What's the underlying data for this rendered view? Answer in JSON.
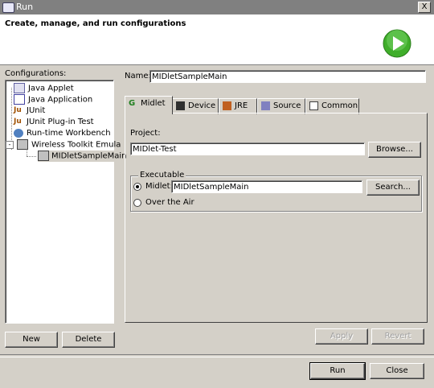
{
  "window": {
    "title": "Run",
    "close_glyph": "X"
  },
  "header": {
    "title": "Create, manage, and run configurations",
    "icon": "run-icon"
  },
  "configurations": {
    "label": "Configurations:",
    "items": [
      {
        "label": "Java Applet",
        "icon": "java-applet-icon"
      },
      {
        "label": "Java Application",
        "icon": "java-application-icon"
      },
      {
        "label": "JUnit",
        "icon": "junit-icon"
      },
      {
        "label": "JUnit Plug-in Test",
        "icon": "junit-plugin-icon"
      },
      {
        "label": "Run-time Workbench",
        "icon": "workbench-icon"
      },
      {
        "label": "Wireless Toolkit Emula",
        "icon": "wireless-toolkit-icon"
      },
      {
        "label": "MIDletSampleMain",
        "icon": "midlet-config-icon"
      }
    ],
    "new_label": "New",
    "delete_label": "Delete"
  },
  "name": {
    "label": "Name:",
    "value": "MIDletSampleMain"
  },
  "tabs": [
    {
      "label": "Midlet",
      "icon": "midlet-tab-icon"
    },
    {
      "label": "Device",
      "icon": "device-icon"
    },
    {
      "label": "JRE",
      "icon": "jre-icon"
    },
    {
      "label": "Source",
      "icon": "source-icon"
    },
    {
      "label": "Common",
      "icon": "common-icon"
    }
  ],
  "midlet_tab": {
    "project_label": "Project:",
    "project_value": "MIDlet-Test",
    "browse_label": "Browse...",
    "executable_label": "Executable",
    "midlet_radio_label": "Midlet:",
    "midlet_value": "MIDletSampleMain",
    "search_label": "Search...",
    "ota_radio_label": "Over the Air"
  },
  "actions": {
    "apply_label": "Apply",
    "revert_label": "Revert",
    "run_label": "Run",
    "close_label": "Close"
  },
  "colors": {
    "selection": "#d4d0c8",
    "run_green": "#3fae2a",
    "titlebar": "#808080"
  }
}
